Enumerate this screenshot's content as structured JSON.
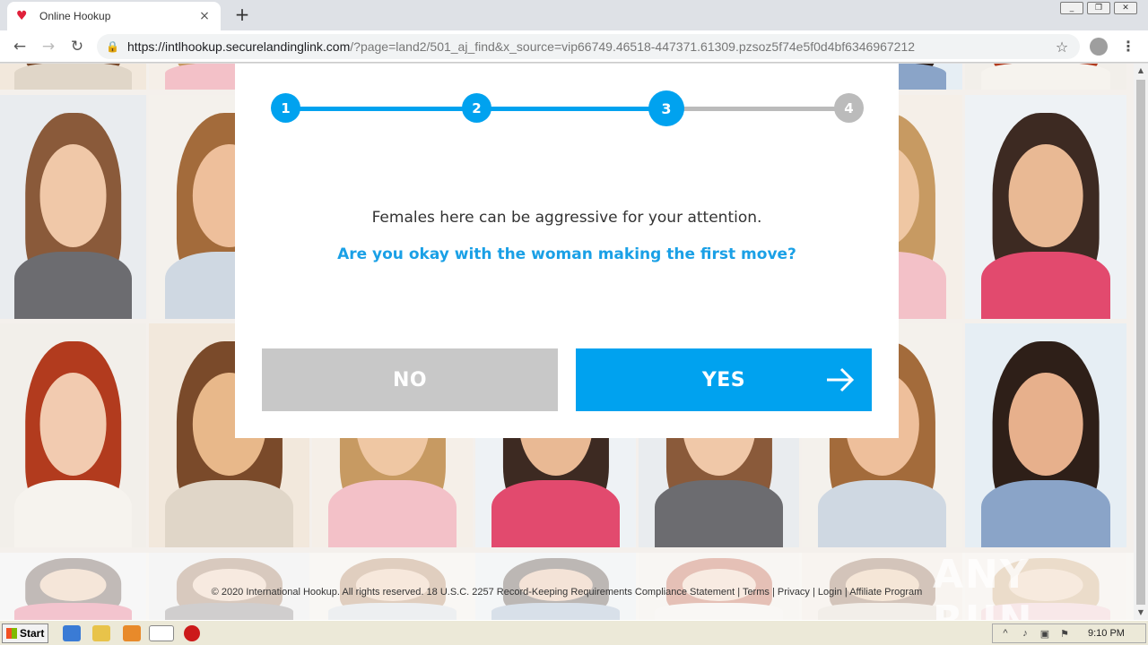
{
  "browser": {
    "tab_title": "Online Hookup",
    "tab_close": "×",
    "new_tab": "+",
    "url_host": "https://intlhookup.securelandinglink.com",
    "url_rest": "/?page=land2/501_aj_find&x_source=vip66749.46518-447371.61309.pzsoz5f74e5f0d4bf6346967212",
    "icons": [
      "heart-favicon",
      "lock-icon",
      "star-icon",
      "profile-icon",
      "menu-icon",
      "back-icon",
      "forward-icon",
      "reload-icon"
    ]
  },
  "steps": {
    "labels": [
      "1",
      "2",
      "3",
      "4"
    ],
    "current": 3,
    "active_color": "#00a2ef",
    "inactive_color": "#bbbbbb"
  },
  "modal": {
    "message": "Females here can be aggressive for your attention.",
    "question": "Are you okay with the woman making the first move?",
    "no_label": "NO",
    "yes_label": "YES"
  },
  "footer": {
    "copyright": "© 2020 International Hookup. All rights reserved. 18 U.S.C. 2257 Record-Keeping Requirements Compliance Statement",
    "sep": " | ",
    "terms": "Terms",
    "privacy": "Privacy",
    "login": "Login",
    "affiliate": "Affiliate Program"
  },
  "watermark": "ANY RUN",
  "taskbar": {
    "start_label": "Start",
    "clock": "9:10 PM",
    "apps": [
      "ie-icon",
      "folder-icon",
      "media-icon",
      "chrome-icon",
      "stop-icon"
    ]
  }
}
